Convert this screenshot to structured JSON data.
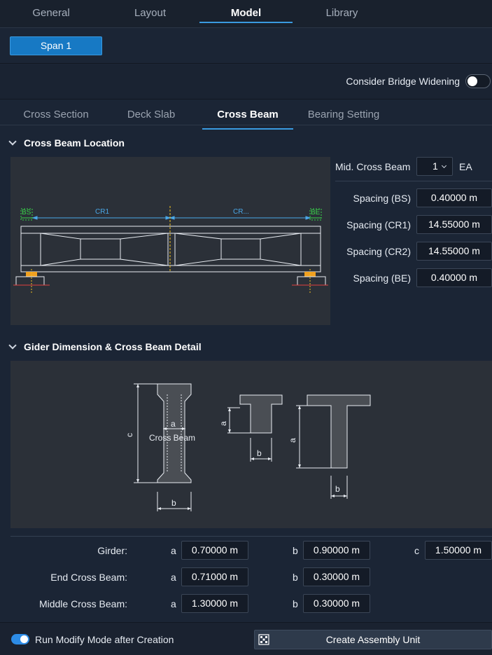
{
  "top_tabs": [
    "General",
    "Layout",
    "Model",
    "Library"
  ],
  "span_button": "Span 1",
  "widening": {
    "label": "Consider Bridge Widening",
    "enabled": false
  },
  "sub_tabs": [
    "Cross Section",
    "Deck Slab",
    "Cross Beam",
    "Bearing Setting"
  ],
  "location": {
    "title": "Cross Beam Location",
    "diagram": {
      "bs": "BS",
      "cr1": "CR1",
      "cr2": "CR...",
      "be": "BE"
    },
    "mid_label": "Mid. Cross Beam",
    "mid_value": "1",
    "mid_unit": "EA",
    "spacing": [
      {
        "label": "Spacing (BS)",
        "value": "0.40000 m"
      },
      {
        "label": "Spacing (CR1)",
        "value": "14.55000 m"
      },
      {
        "label": "Spacing (CR2)",
        "value": "14.55000 m"
      },
      {
        "label": "Spacing (BE)",
        "value": "0.40000 m"
      }
    ]
  },
  "detail": {
    "title": "Gider Dimension & Cross Beam Detail",
    "diagram": {
      "a": "a",
      "b": "b",
      "c": "c",
      "cross_beam": "Cross Beam"
    },
    "rows": [
      {
        "label": "Girder:",
        "a": "0.70000 m",
        "b": "0.90000 m",
        "c": "1.50000 m"
      },
      {
        "label": "End Cross Beam:",
        "a": "0.71000 m",
        "b": "0.30000 m"
      },
      {
        "label": "Middle Cross Beam:",
        "a": "1.30000 m",
        "b": "0.30000 m"
      }
    ],
    "letters": {
      "a": "a",
      "b": "b",
      "c": "c"
    }
  },
  "run_modify": {
    "label": "Run Modify Mode after Creation",
    "enabled": true
  },
  "create_button": "Create Assembly Unit"
}
